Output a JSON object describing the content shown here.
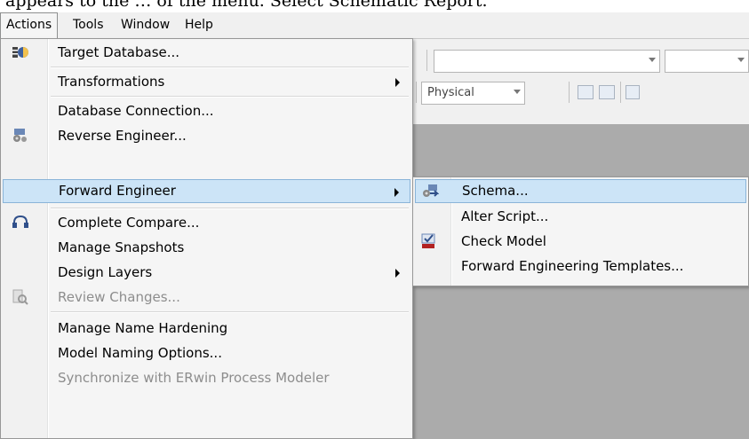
{
  "top_fragment": "appears to the … of the menu. Select Schematic Report.",
  "menubar": {
    "items": [
      {
        "label": "Actions"
      },
      {
        "label": "Tools"
      },
      {
        "label": "Window"
      },
      {
        "label": "Help"
      }
    ]
  },
  "toolbar": {
    "view_combo": "Physical"
  },
  "actions_menu": {
    "items": [
      {
        "label": "Target Database...",
        "icon": "target-database-icon"
      },
      {
        "label": "Transformations",
        "submenu": true
      },
      {
        "label": "Database Connection..."
      },
      {
        "label": "Reverse Engineer...",
        "icon": "reverse-engineer-icon"
      },
      {
        "label": "Forward Engineer",
        "submenu": true,
        "highlighted": true
      },
      {
        "label": "Complete Compare...",
        "icon": "complete-compare-icon"
      },
      {
        "label": "Manage Snapshots"
      },
      {
        "label": "Design Layers",
        "submenu": true
      },
      {
        "label": "Review Changes...",
        "disabled": true,
        "icon": "review-changes-icon"
      },
      {
        "label": "Manage Name Hardening"
      },
      {
        "label": "Model Naming Options..."
      },
      {
        "label": "Synchronize with ERwin Process Modeler",
        "disabled": true
      }
    ]
  },
  "forward_engineer_menu": {
    "items": [
      {
        "label": "Schema...",
        "highlighted": true,
        "icon": "schema-icon"
      },
      {
        "label": "Alter Script..."
      },
      {
        "label": "Check Model",
        "icon": "check-model-sql-icon"
      },
      {
        "label": "Forward Engineering Templates..."
      }
    ]
  },
  "colors": {
    "highlight": "#cce4f7",
    "highlight_border": "#8ab4d8",
    "canvas": "#ababab",
    "menu_bg": "#f5f5f5"
  }
}
